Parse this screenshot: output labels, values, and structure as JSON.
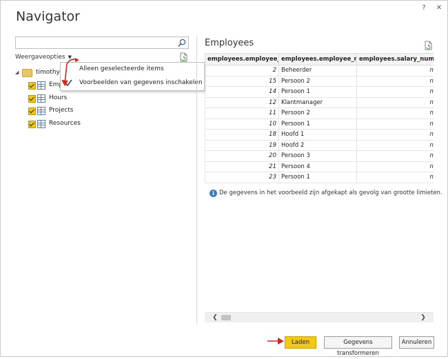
{
  "window": {
    "title": "Navigator",
    "help_glyph": "?",
    "close_glyph": "✕"
  },
  "left": {
    "search": {
      "value": "",
      "placeholder": ""
    },
    "options_label": "Weergaveopties",
    "menu": {
      "items": [
        {
          "label": "Alleen geselecteerde items",
          "checked": false
        },
        {
          "label": "Voorbeelden van gegevens inschakelen",
          "checked": true
        }
      ]
    },
    "tree": {
      "root": {
        "label": "timothy:",
        "expanded": true
      },
      "items": [
        {
          "label": "Employees",
          "checked": true
        },
        {
          "label": "Hours",
          "checked": true
        },
        {
          "label": "Projects",
          "checked": true
        },
        {
          "label": "Resources",
          "checked": true
        }
      ]
    }
  },
  "preview": {
    "title": "Employees",
    "columns": [
      "employees.employee_id",
      "employees.employee_name",
      "employees.salary_number"
    ],
    "rows": [
      [
        "2",
        "Beheerder",
        "null"
      ],
      [
        "15",
        "Persoon 2",
        "null"
      ],
      [
        "14",
        "Persoon 1",
        "null"
      ],
      [
        "12",
        "Klantmanager",
        "null"
      ],
      [
        "11",
        "Persoon 2",
        "null"
      ],
      [
        "10",
        "Persoon 1",
        "null"
      ],
      [
        "18",
        "Hoofd 1",
        "null"
      ],
      [
        "19",
        "Hoofd 2",
        "null"
      ],
      [
        "20",
        "Persoon 3",
        "null"
      ],
      [
        "21",
        "Persoon 4",
        "null"
      ],
      [
        "23",
        "Persoon 1",
        "null"
      ]
    ],
    "info_text": "De gegevens in het voorbeeld zijn afgekapt als gevolg van grootte limieten."
  },
  "footer": {
    "load_label": "Laden",
    "transform_label": "Gegevens transformeren",
    "cancel_label": "Annuleren"
  },
  "colors": {
    "accent": "#f2c811",
    "annotation": "#e02020",
    "info": "#3f78c3"
  }
}
